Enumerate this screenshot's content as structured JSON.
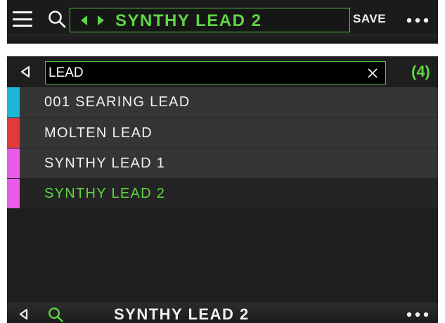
{
  "header": {
    "menu_icon": "hamburger-icon",
    "search_icon": "search-icon",
    "preset_name": "SYNTHY LEAD 2",
    "save_label": "SAVE",
    "more_icon": "more-dots-icon"
  },
  "search": {
    "value": "LEAD",
    "clear_icon": "close-icon",
    "result_count": "(4)"
  },
  "results": [
    {
      "label": "001 SEARING LEAD",
      "color": "#1ab7d6",
      "selected": false
    },
    {
      "label": "MOLTEN LEAD",
      "color": "#e23b3b",
      "selected": false
    },
    {
      "label": "SYNTHY LEAD 1",
      "color": "#e95be8",
      "selected": false
    },
    {
      "label": "SYNTHY LEAD 2",
      "color": "#e95be8",
      "selected": true
    }
  ],
  "footer": {
    "back_icon": "back-triangle-icon",
    "search_icon": "search-icon",
    "preset_name": "SYNTHY LEAD 2",
    "more_icon": "more-dots-icon"
  },
  "colors": {
    "accent": "#5ed542",
    "background": "#1e1e1e",
    "row": "#353535",
    "text": "#f2f2f2"
  }
}
